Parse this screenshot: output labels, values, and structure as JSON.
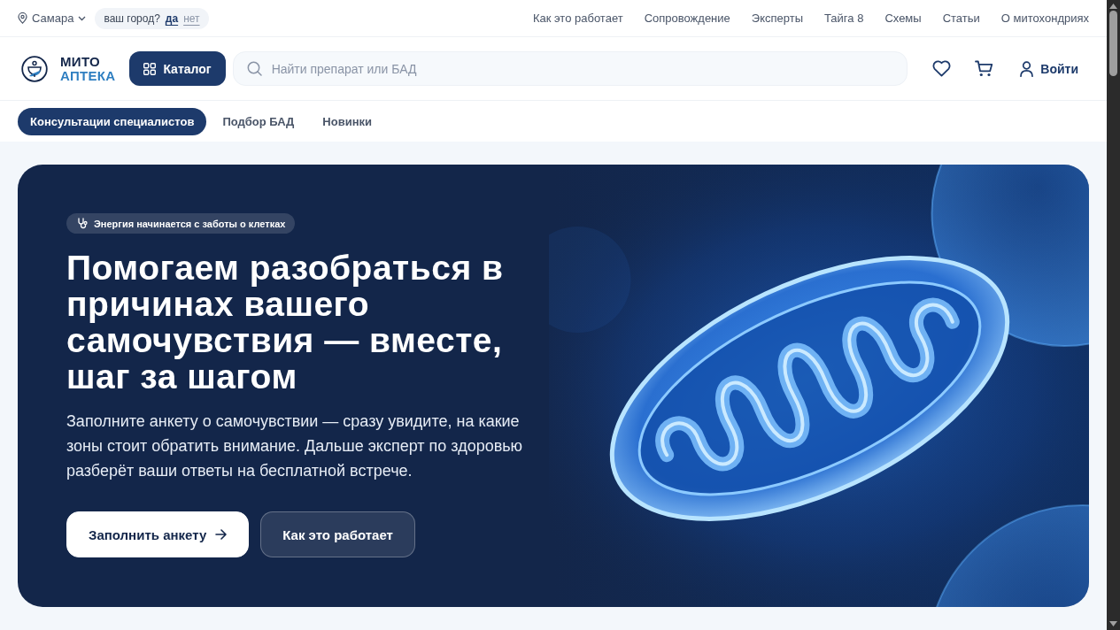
{
  "top_bar": {
    "city": "Самара",
    "city_prompt": {
      "question": "ваш город?",
      "answers": [
        {
          "label": "да",
          "kind": "primary"
        },
        {
          "label": "нет",
          "kind": "secondary"
        }
      ]
    },
    "links": [
      "Как это работает",
      "Сопровождение",
      "Эксперты",
      "Тайга 8",
      "Схемы",
      "Статьи",
      "О митохондриях"
    ]
  },
  "header": {
    "logo": {
      "line_1": "МИТО",
      "line_2": "АПТЕКА"
    },
    "catalog_button": "Каталог",
    "search": {
      "placeholder": "Найти препарат или БАД"
    },
    "login_button": "Войти"
  },
  "sub_nav": [
    {
      "label": "Консультации специалистов",
      "selected": true
    },
    {
      "label": "Подбор БАД",
      "selected": false
    },
    {
      "label": "Новинки",
      "selected": false
    }
  ],
  "hero": {
    "tag": "Энергия начинается с заботы о клетках",
    "title": "Помогаем разобраться в причинах вашего самочувствия — вместе, шаг за шагом",
    "text": "Заполните анкету о самочувствии — сразу увидите, на какие зоны стоит обратить внимание. Дальше эксперт по здоровью разберёт ваши ответы на бесплатной встрече.",
    "buttons": [
      {
        "label": "Заполнить анкету",
        "kind": "primary"
      },
      {
        "label": "Как это работает",
        "kind": "secondary"
      }
    ]
  }
}
